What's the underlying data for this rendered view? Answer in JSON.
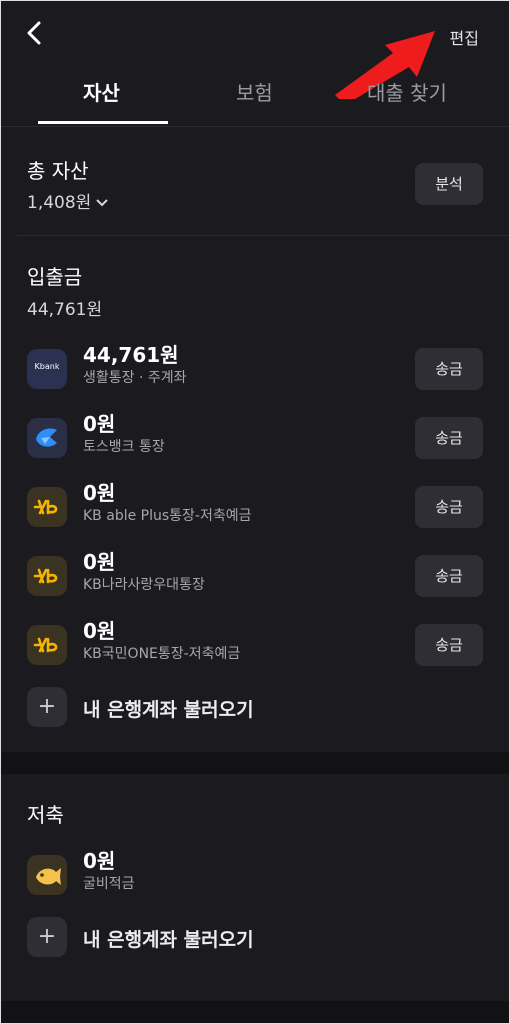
{
  "header": {
    "back_icon": "chevron-left-icon",
    "edit_label": "편집"
  },
  "tabs": [
    {
      "label": "자산",
      "active": true
    },
    {
      "label": "보험",
      "active": false
    },
    {
      "label": "대출 찾기",
      "active": false
    }
  ],
  "total": {
    "title": "총 자산",
    "amount": "1,408원",
    "analysis_label": "분석"
  },
  "deposits": {
    "title": "입출금",
    "total": "44,761원",
    "accounts": [
      {
        "amount": "44,761원",
        "name": "생활통장 · 주계좌",
        "logo": "kbank-logo",
        "logo_text": "Kbank",
        "send_label": "송금"
      },
      {
        "amount": "0원",
        "name": "토스뱅크 통장",
        "logo": "toss-logo",
        "send_label": "송금"
      },
      {
        "amount": "0원",
        "name": "KB able Plus통장-저축예금",
        "logo": "kb-logo",
        "send_label": "송금"
      },
      {
        "amount": "0원",
        "name": "KB나라사랑우대통장",
        "logo": "kb-logo",
        "send_label": "송금"
      },
      {
        "amount": "0원",
        "name": "KB국민ONE통장-저축예금",
        "logo": "kb-logo",
        "send_label": "송금"
      }
    ],
    "add_label": "내 은행계좌 불러오기"
  },
  "savings": {
    "title": "저축",
    "accounts": [
      {
        "amount": "0원",
        "name": "굴비적금",
        "logo": "fish-logo"
      }
    ],
    "add_label": "내 은행계좌 불러오기"
  },
  "colors": {
    "background": "#1b1b1f",
    "button": "#2e2e34",
    "arrow": "#ee1c1c",
    "kb_yellow": "#f4b400",
    "toss_blue": "#2e8ef7"
  }
}
